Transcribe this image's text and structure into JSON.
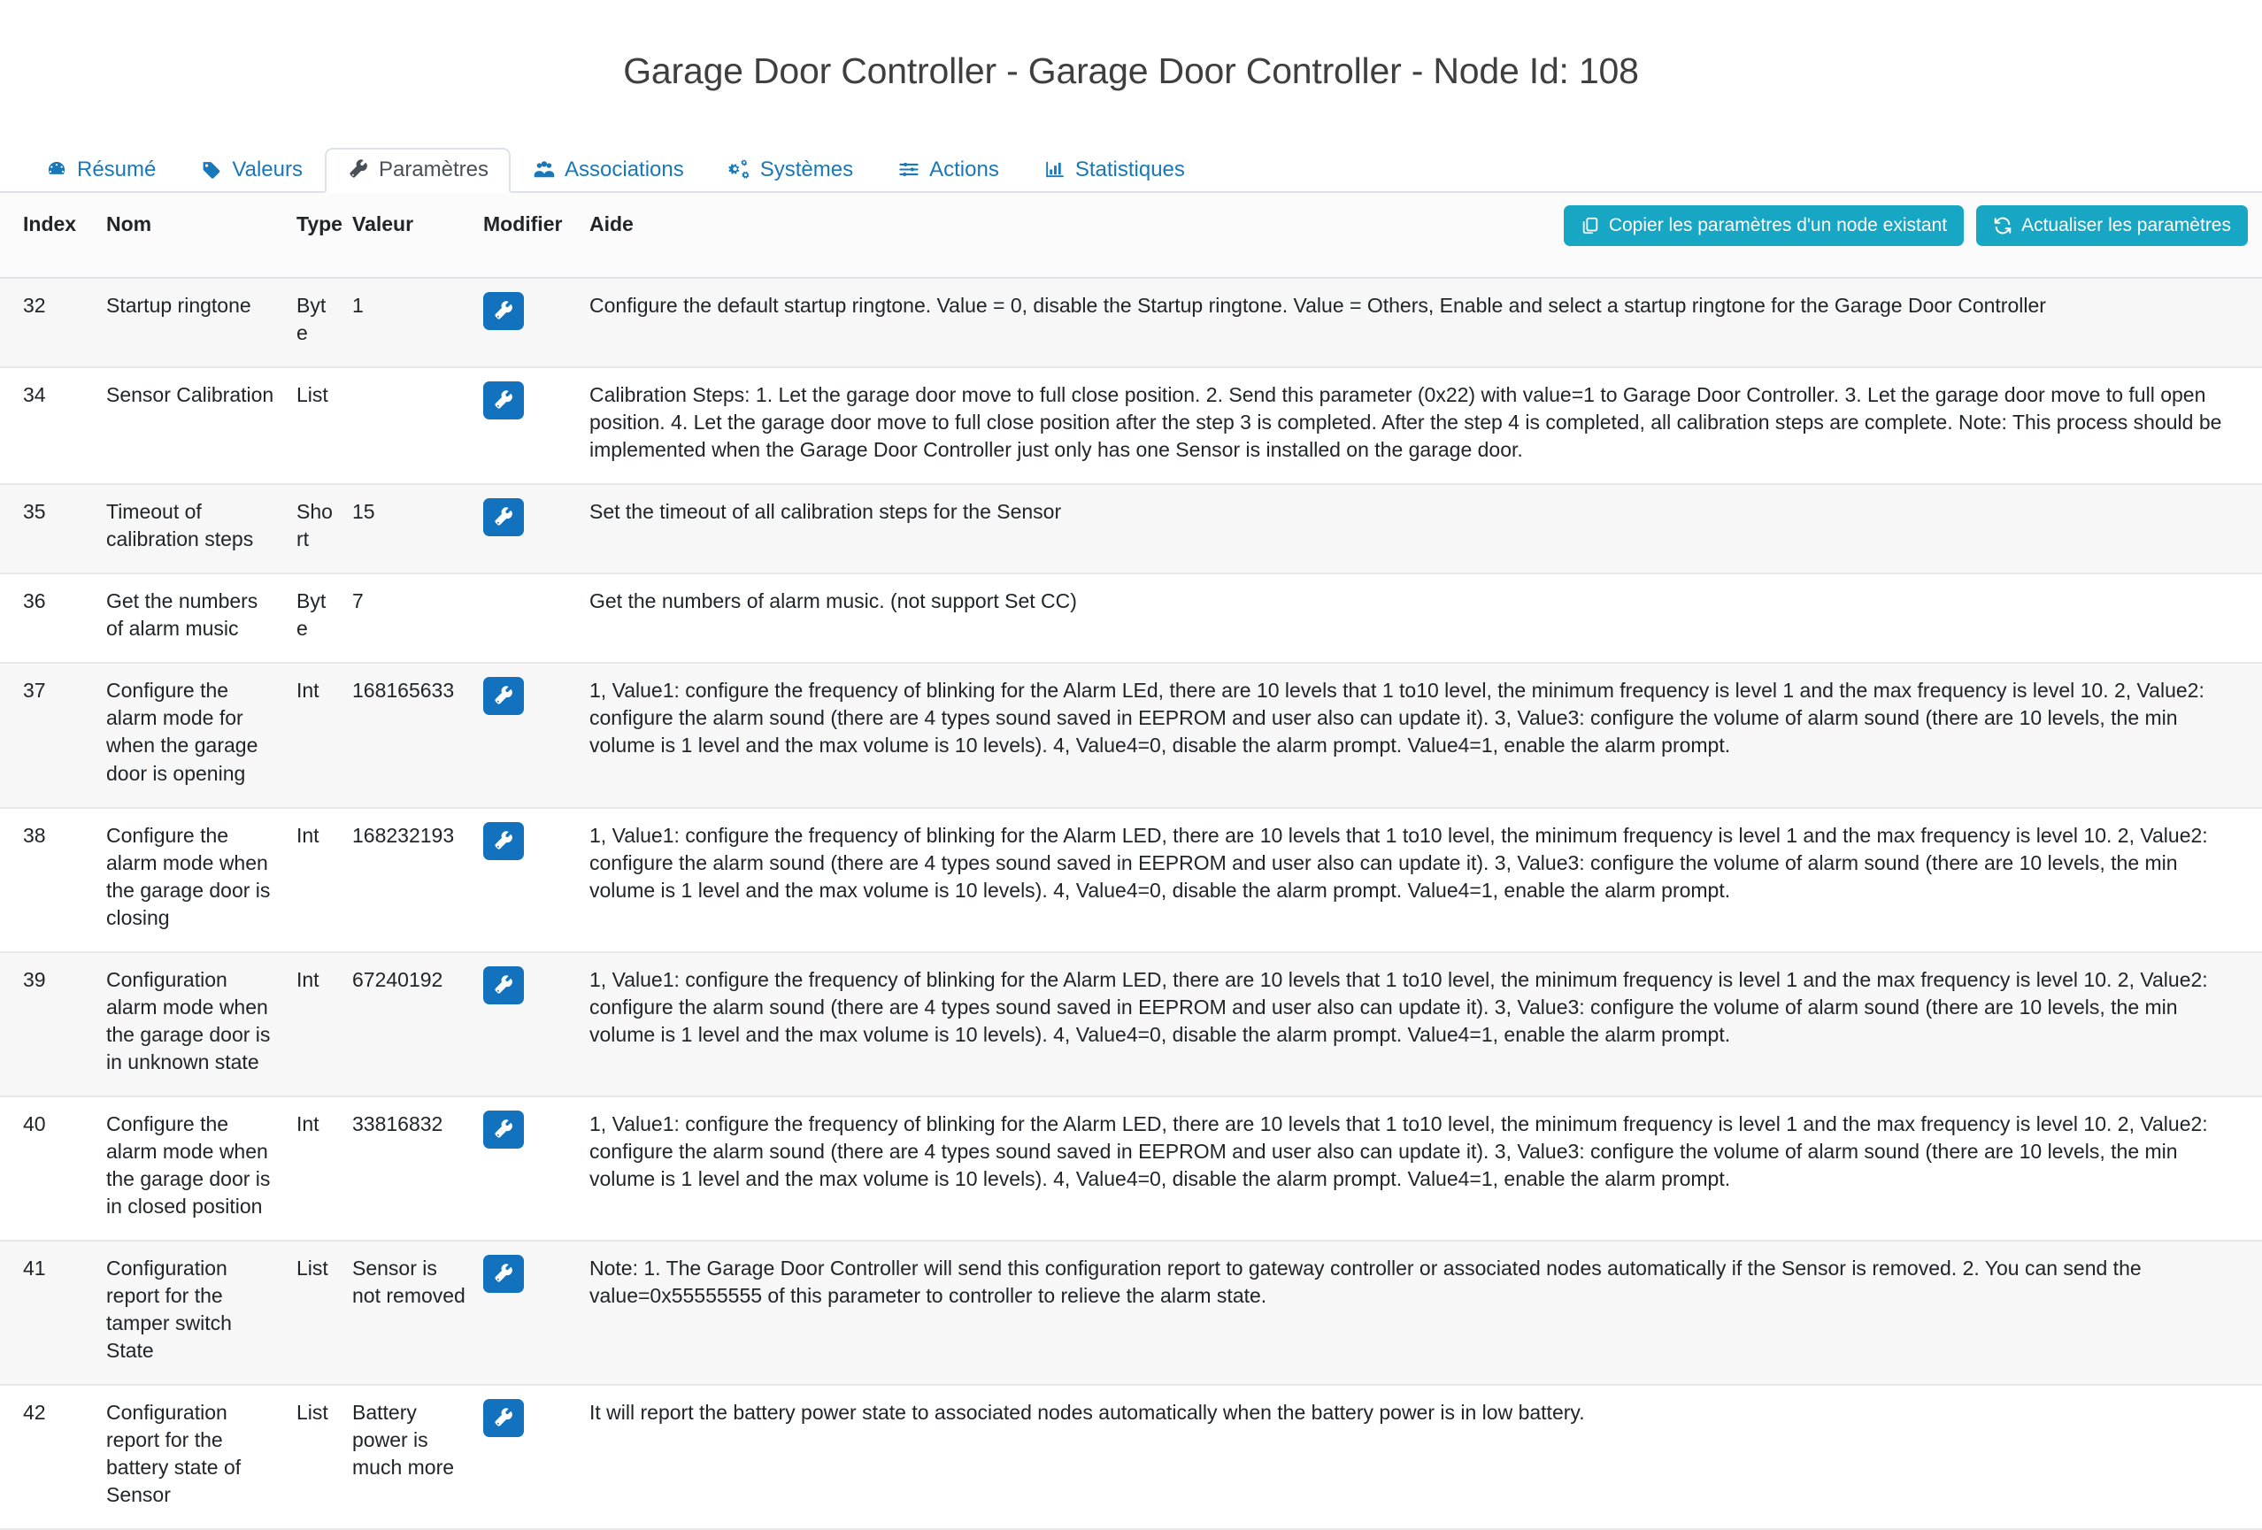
{
  "page_title": "Garage Door Controller - Garage Door Controller - Node Id: 108",
  "tabs": [
    {
      "label": "Résumé",
      "icon": "dashboard-icon",
      "active": false
    },
    {
      "label": "Valeurs",
      "icon": "tag-icon",
      "active": false
    },
    {
      "label": "Paramètres",
      "icon": "wrench-icon",
      "active": true
    },
    {
      "label": "Associations",
      "icon": "users-icon",
      "active": false
    },
    {
      "label": "Systèmes",
      "icon": "cogs-icon",
      "active": false
    },
    {
      "label": "Actions",
      "icon": "sliders-icon",
      "active": false
    },
    {
      "label": "Statistiques",
      "icon": "chart-bar-icon",
      "active": false
    }
  ],
  "toolbar": {
    "copy_label": "Copier les paramètres d'un node existant",
    "refresh_label": "Actualiser les paramètres",
    "copy_icon": "copy-icon",
    "refresh_icon": "refresh-icon",
    "button_color": "#17a6c4"
  },
  "table": {
    "columns": [
      "Index",
      "Nom",
      "Type",
      "Valeur",
      "Modifier",
      "Aide"
    ],
    "edit_button_color": "#1272bd",
    "rows": [
      {
        "index": "32",
        "nom": "Startup ringtone",
        "type": "Byte",
        "valeur": "1",
        "has_edit": true,
        "aide": "Configure the default startup ringtone. Value = 0, disable the Startup ringtone. Value = Others, Enable and select a startup ringtone for the Garage Door Controller"
      },
      {
        "index": "34",
        "nom": "Sensor Calibration",
        "type": "List",
        "valeur": "",
        "has_edit": true,
        "aide": "Calibration Steps: 1. Let the garage door move to full close position. 2. Send this parameter (0x22) with value=1 to Garage Door Controller. 3. Let the garage door move to full open position. 4. Let the garage door move to full close position after the step 3 is completed. After the step 4 is completed, all calibration steps are complete. Note: This process should be implemented when the Garage Door Controller just only has one Sensor is installed on the garage door."
      },
      {
        "index": "35",
        "nom": "Timeout of calibration steps",
        "type": "Short",
        "valeur": "15",
        "has_edit": true,
        "aide": "Set the timeout of all calibration steps for the Sensor"
      },
      {
        "index": "36",
        "nom": "Get the numbers of alarm music",
        "type": "Byte",
        "valeur": "7",
        "has_edit": false,
        "aide": "Get the numbers of alarm music. (not support Set CC)"
      },
      {
        "index": "37",
        "nom": "Configure the alarm mode for when the garage door is opening",
        "type": "Int",
        "valeur": "168165633",
        "has_edit": true,
        "aide": "1, Value1: configure the frequency of blinking for the Alarm LEd, there are 10 levels that 1 to10 level, the minimum frequency is level 1 and the max frequency is level 10. 2, Value2: configure the alarm sound (there are 4 types sound saved in EEPROM and user also can update it). 3, Value3: configure the volume of alarm sound (there are 10 levels, the min volume is 1 level and the max volume is 10 levels). 4, Value4=0, disable the alarm prompt. Value4=1, enable the alarm prompt."
      },
      {
        "index": "38",
        "nom": "Configure the alarm mode when the garage door is closing",
        "type": "Int",
        "valeur": "168232193",
        "has_edit": true,
        "aide": "1, Value1: configure the frequency of blinking for the Alarm LED, there are 10 levels that 1 to10 level, the minimum frequency is level 1 and the max frequency is level 10. 2, Value2: configure the alarm sound (there are 4 types sound saved in EEPROM and user also can update it). 3, Value3: configure the volume of alarm sound (there are 10 levels, the min volume is 1 level and the max volume is 10 levels). 4, Value4=0, disable the alarm prompt. Value4=1, enable the alarm prompt."
      },
      {
        "index": "39",
        "nom": "Configuration alarm mode when the garage door is in unknown state",
        "type": "Int",
        "valeur": "67240192",
        "has_edit": true,
        "aide": "1, Value1: configure the frequency of blinking for the Alarm LED, there are 10 levels that 1 to10 level, the minimum frequency is level 1 and the max frequency is level 10. 2, Value2: configure the alarm sound (there are 4 types sound saved in EEPROM and user also can update it). 3, Value3: configure the volume of alarm sound (there are 10 levels, the min volume is 1 level and the max volume is 10 levels). 4, Value4=0, disable the alarm prompt. Value4=1, enable the alarm prompt."
      },
      {
        "index": "40",
        "nom": "Configure the alarm mode when the garage door is in closed position",
        "type": "Int",
        "valeur": "33816832",
        "has_edit": true,
        "aide": "1, Value1: configure the frequency of blinking for the Alarm LED, there are 10 levels that 1 to10 level, the minimum frequency is level 1 and the max frequency is level 10. 2, Value2: configure the alarm sound (there are 4 types sound saved in EEPROM and user also can update it). 3, Value3: configure the volume of alarm sound (there are 10 levels, the min volume is 1 level and the max volume is 10 levels). 4, Value4=0, disable the alarm prompt. Value4=1, enable the alarm prompt."
      },
      {
        "index": "41",
        "nom": "Configuration report for the tamper switch State",
        "type": "List",
        "valeur": "Sensor is not removed",
        "has_edit": true,
        "aide": "Note: 1. The Garage Door Controller will send this configuration report to gateway controller or associated nodes automatically if the Sensor is removed. 2. You can send the value=0x55555555 of this parameter to controller to relieve the alarm state."
      },
      {
        "index": "42",
        "nom": "Configuration report for the battery state of Sensor",
        "type": "List",
        "valeur": "Battery power is much more",
        "has_edit": true,
        "aide": "It will report the battery power state to associated nodes automatically when the battery power is in low battery."
      }
    ]
  }
}
